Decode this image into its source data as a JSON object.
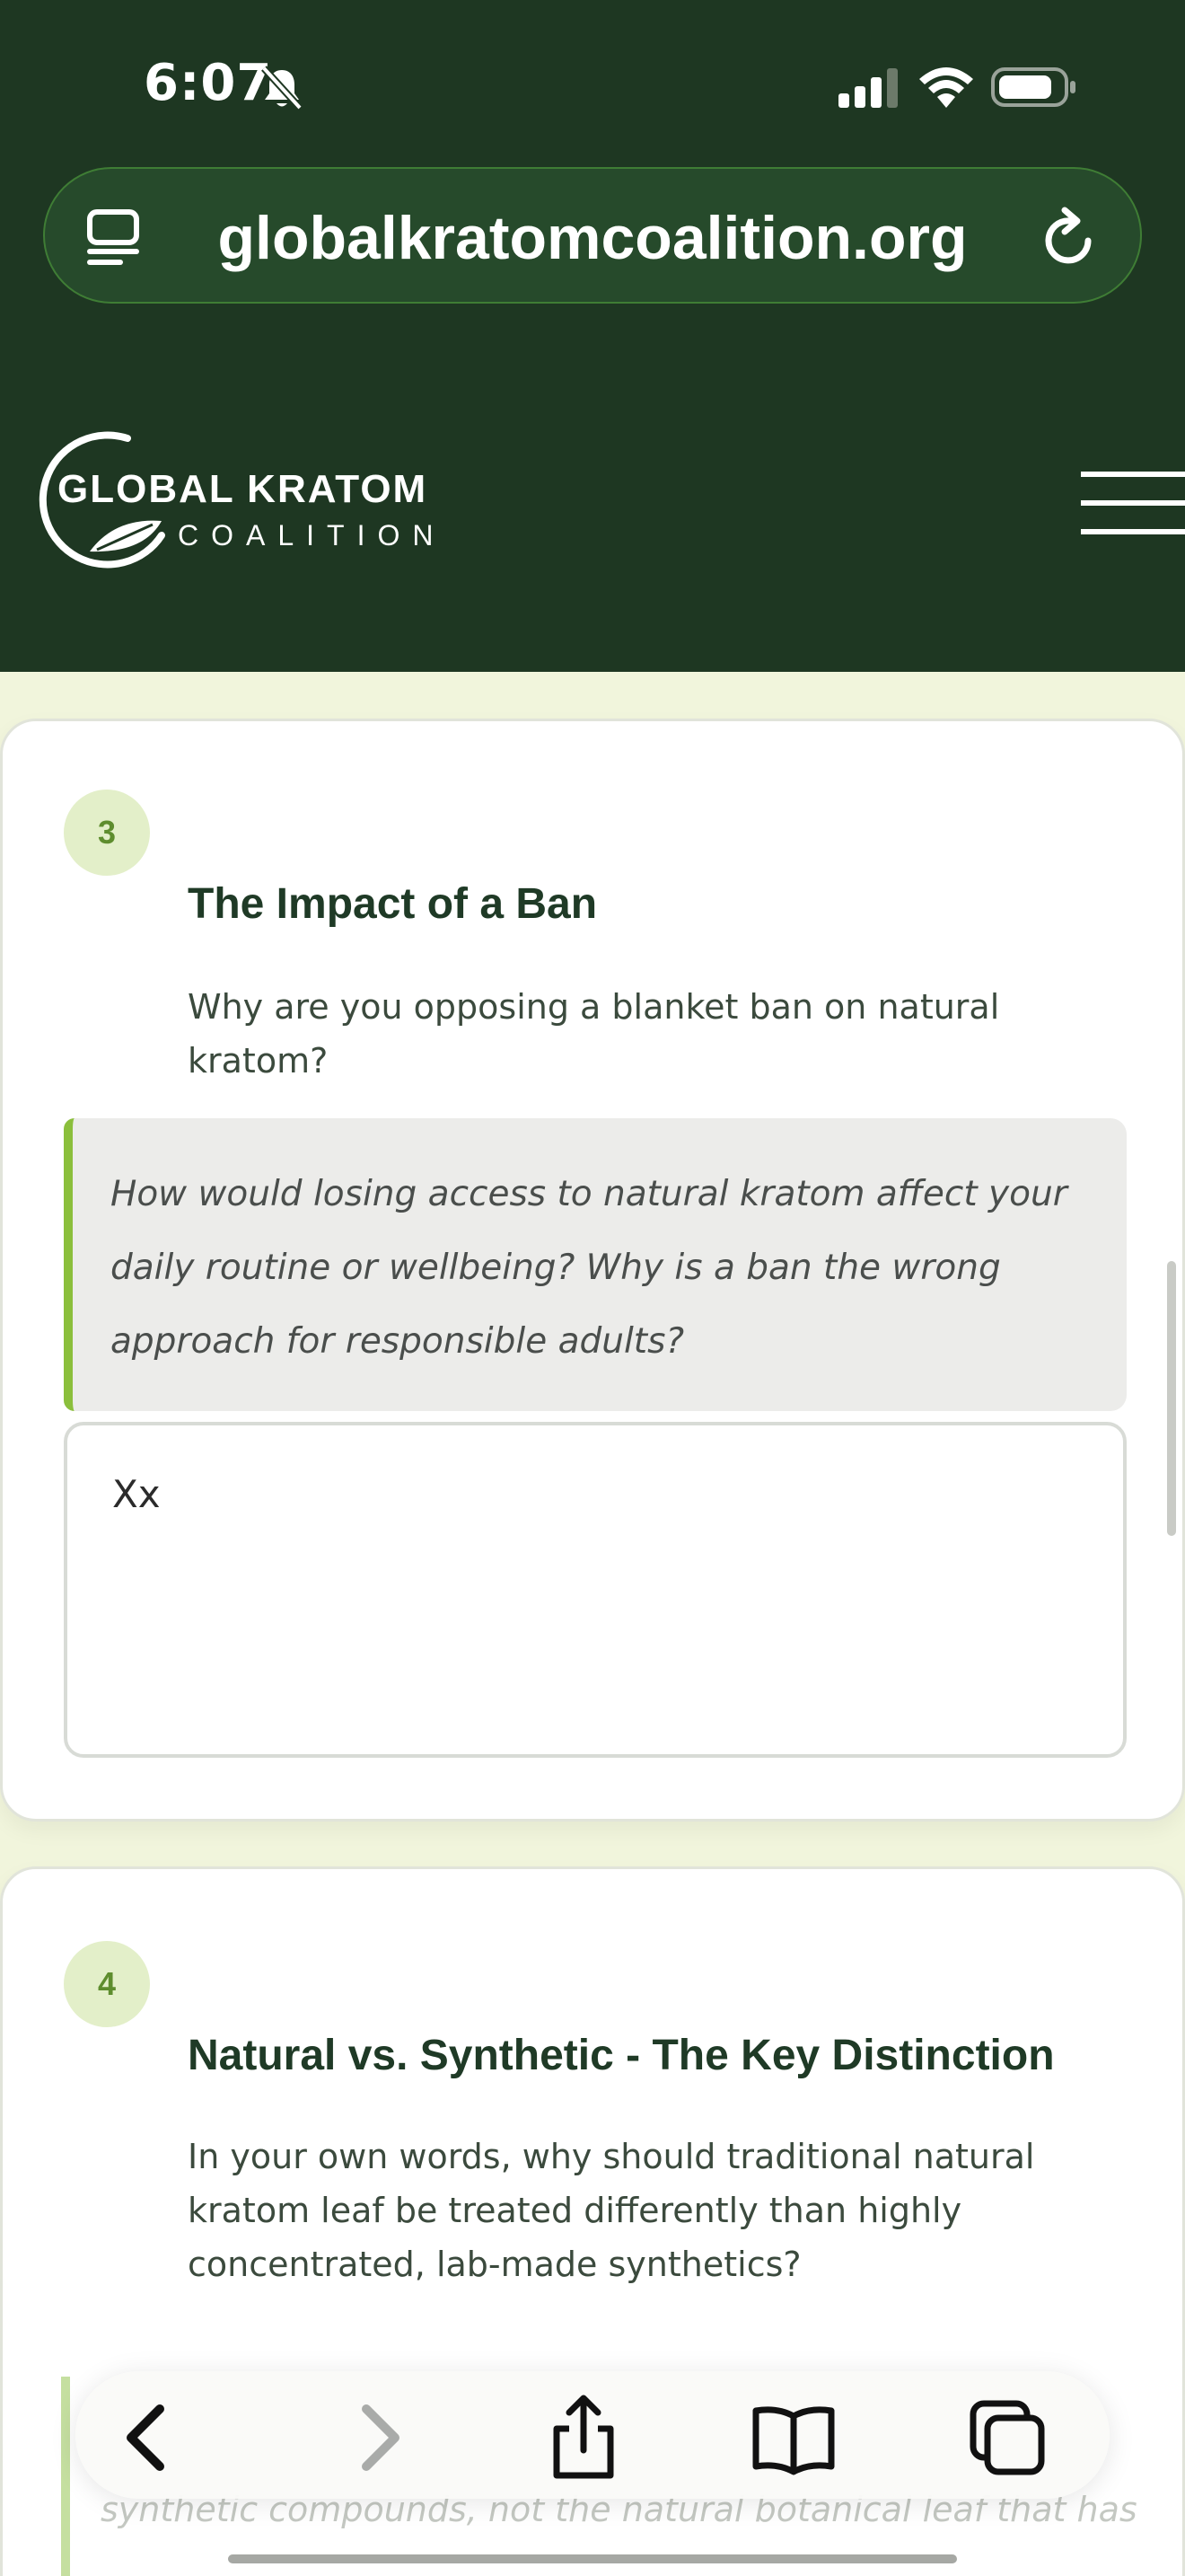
{
  "status_bar": {
    "time": "6:07",
    "icons": [
      "bell-slash-icon",
      "cellular-signal-icon",
      "wifi-icon",
      "battery-icon"
    ]
  },
  "browser": {
    "url": "globalkratomcoalition.org",
    "icons": [
      "reader-icon",
      "reload-icon"
    ]
  },
  "site_header": {
    "logo_line1": "GLOBAL KRATOM",
    "logo_line2": "COALITION",
    "menu_icon": "hamburger-menu-icon",
    "background": "#1e3722"
  },
  "cards": [
    {
      "number": "3",
      "title": "The Impact of a Ban",
      "question": "Why are you opposing a blanket ban on natural kratom?",
      "prompt": "How would losing access to natural kratom affect your daily routine or wellbeing? Why is a ban the wrong approach for responsible adults?",
      "answer": "Xx"
    },
    {
      "number": "4",
      "title": "Natural vs. Synthetic - The Key Distinction",
      "question": "In your own words, why should traditional natural kratom leaf be treated differently than highly concentrated, lab-made synthetics?",
      "prompt_partial": "synthetic compounds, not the natural botanical leaf that has"
    }
  ],
  "toolbar": {
    "buttons": [
      "back-icon",
      "forward-icon",
      "share-icon",
      "bookmarks-icon",
      "tabs-icon"
    ]
  },
  "colors": {
    "accent_green": "#8bbf3c",
    "badge_bg": "#e3efc9",
    "page_bg": "#f1f5dc",
    "title_text": "#1f3a26"
  }
}
